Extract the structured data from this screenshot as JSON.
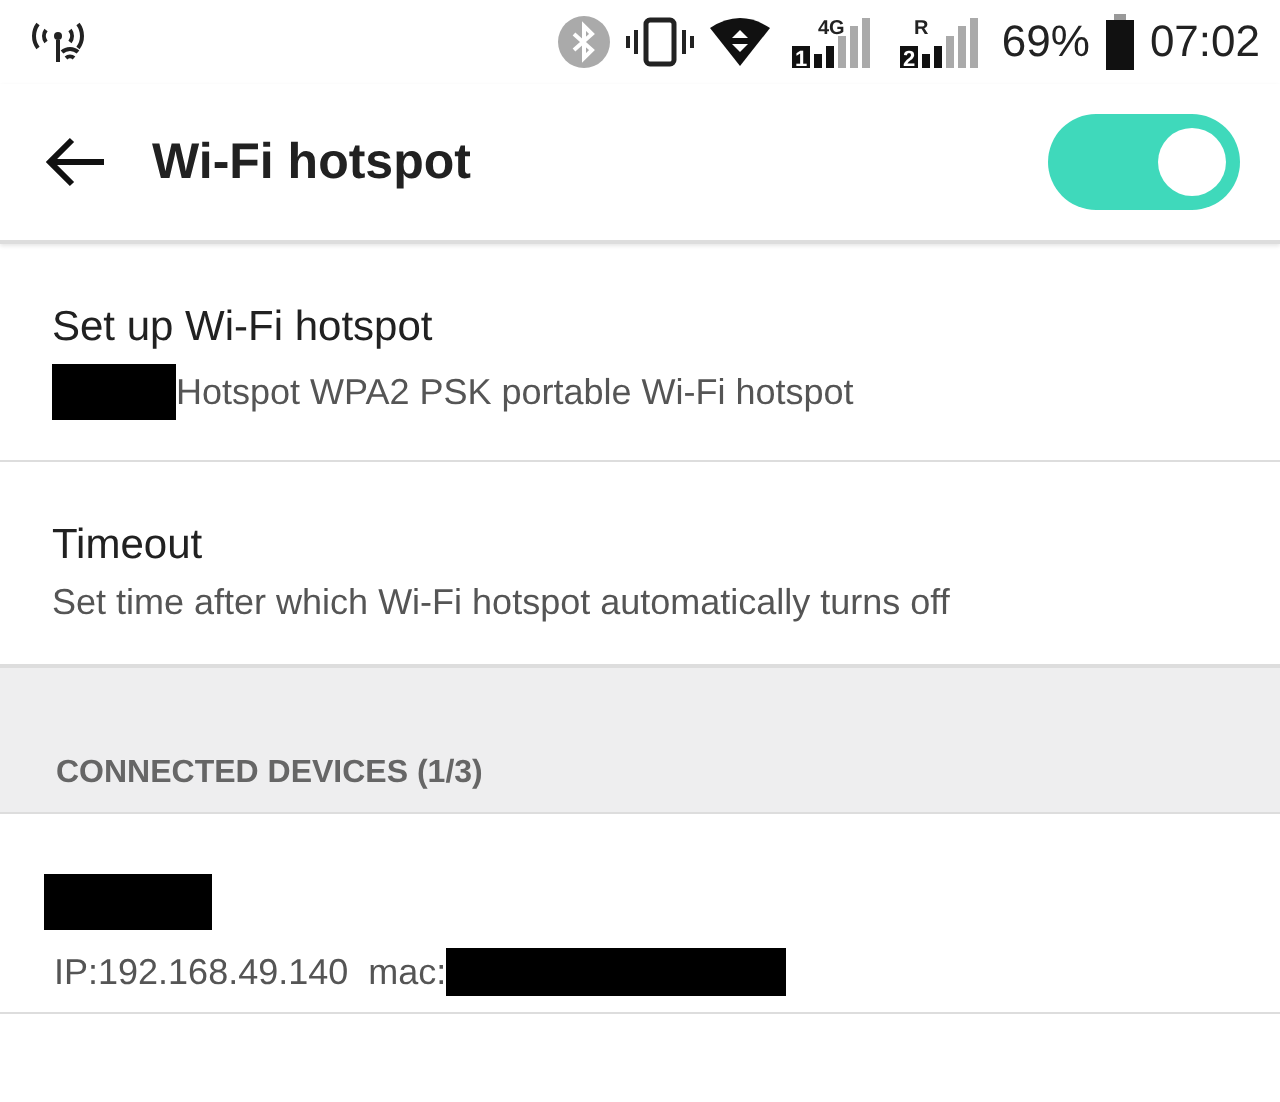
{
  "status_bar": {
    "signals": [
      {
        "badge": "4G",
        "slot": "1"
      },
      {
        "badge": "R",
        "slot": "2"
      }
    ],
    "battery": "69%",
    "time": "07:02"
  },
  "toolbar": {
    "title": "Wi-Fi hotspot",
    "switch_on": true
  },
  "settings": [
    {
      "title": "Set up Wi-Fi hotspot",
      "summary": "Hotspot WPA2 PSK portable Wi-Fi hotspot",
      "redacted_prefix": true
    },
    {
      "title": "Timeout",
      "summary": "Set time after which Wi-Fi hotspot automatically turns off",
      "redacted_prefix": false
    }
  ],
  "section_header": "CONNECTED DEVICES (1/3)",
  "devices": [
    {
      "ip": "IP:192.168.49.140",
      "mac_label": "mac:"
    }
  ]
}
